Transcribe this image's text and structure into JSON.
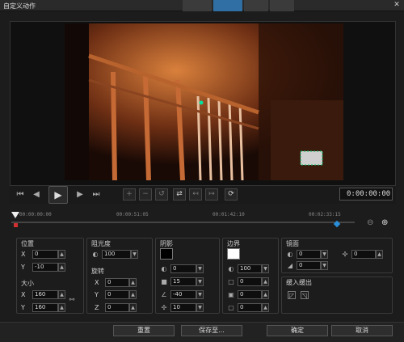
{
  "window": {
    "title": "自定义动作",
    "close": "✕"
  },
  "transport": {
    "timecode": "0:00:00:00"
  },
  "timeline": {
    "ticks": [
      "00:00:00:00",
      "00:00:51:05",
      "00:01:42:10",
      "00:02:33:15"
    ]
  },
  "position": {
    "title": "位置",
    "x_label": "X",
    "x_value": "0",
    "y_label": "Y",
    "y_value": "-10"
  },
  "size": {
    "title": "大小",
    "x_label": "X",
    "x_value": "160",
    "y_label": "Y",
    "y_value": "160"
  },
  "opacity": {
    "title": "阻光度",
    "value": "100"
  },
  "rotation": {
    "title": "旋转",
    "x_label": "X",
    "x_value": "0",
    "y_label": "Y",
    "y_value": "0",
    "z_label": "Z",
    "z_value": "0"
  },
  "shadow": {
    "title": "阴影",
    "color": "#000000",
    "opacity": "0",
    "blur": "15",
    "angle": "-40",
    "distance": "10"
  },
  "border": {
    "title": "边界",
    "color": "#ffffff",
    "opacity": "100",
    "v1": "0",
    "v2": "0",
    "v3": "0"
  },
  "mirror": {
    "title": "镜面",
    "v1": "0",
    "v2": "0",
    "v3": "0"
  },
  "fade": {
    "title": "缓入缓出"
  },
  "buttons": {
    "reset": "重置",
    "save_to": "保存至...",
    "ok": "确定",
    "cancel": "取消"
  },
  "colors": {
    "accent": "#2a8fd8",
    "panel_border": "#3a3a3a"
  }
}
